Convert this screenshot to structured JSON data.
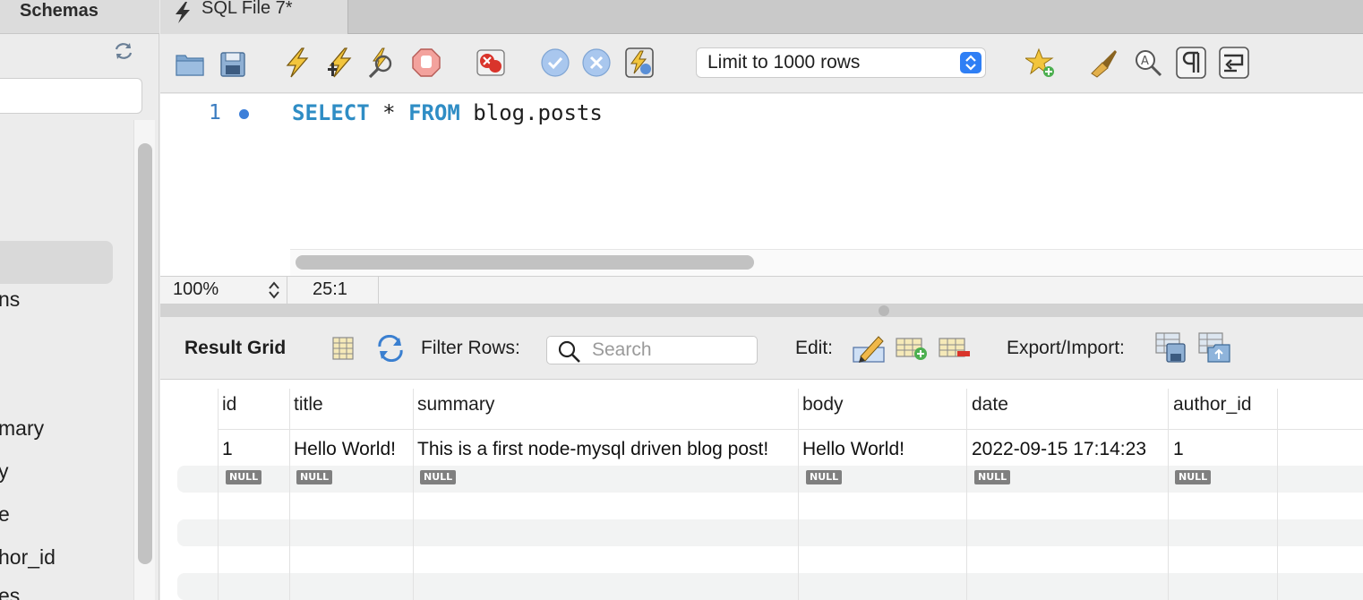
{
  "sidebar": {
    "title": "Schemas",
    "tree_items": [
      "ns",
      "mary",
      "y",
      "e",
      "hor_id",
      "es"
    ]
  },
  "tab": {
    "label": "SQL File 7*"
  },
  "toolbar": {
    "limit_label": "Limit to 1000 rows",
    "icons": [
      "open-folder-icon",
      "save-icon",
      "execute-icon",
      "execute-current-icon",
      "explain-icon",
      "stop-icon",
      "toggle-error-icon",
      "commit-icon",
      "rollback-icon",
      "autocommit-icon",
      "add-snippet-icon",
      "beautify-icon",
      "find-icon",
      "invisibles-icon",
      "wrap-icon"
    ]
  },
  "editor": {
    "line_number": "1",
    "kw1": "SELECT",
    "star": " * ",
    "kw2": "FROM",
    "rest": " blog.posts"
  },
  "status": {
    "zoom": "100%",
    "cursor": "25:1"
  },
  "result": {
    "grid_label": "Result Grid",
    "filter_label": "Filter Rows:",
    "search_placeholder": "Search",
    "edit_label": "Edit:",
    "export_label": "Export/Import:",
    "columns": [
      "id",
      "title",
      "summary",
      "body",
      "date",
      "author_id"
    ],
    "row": [
      "1",
      "Hello World!",
      "This is a first node-mysql driven blog post!",
      "Hello World!",
      "2022-09-15 17:14:23",
      "1"
    ],
    "null_text": "NULL"
  },
  "colors": {
    "keyword": "#2f8dc5",
    "line_number": "#3a7cc0",
    "accent": "#2f7ff5"
  }
}
